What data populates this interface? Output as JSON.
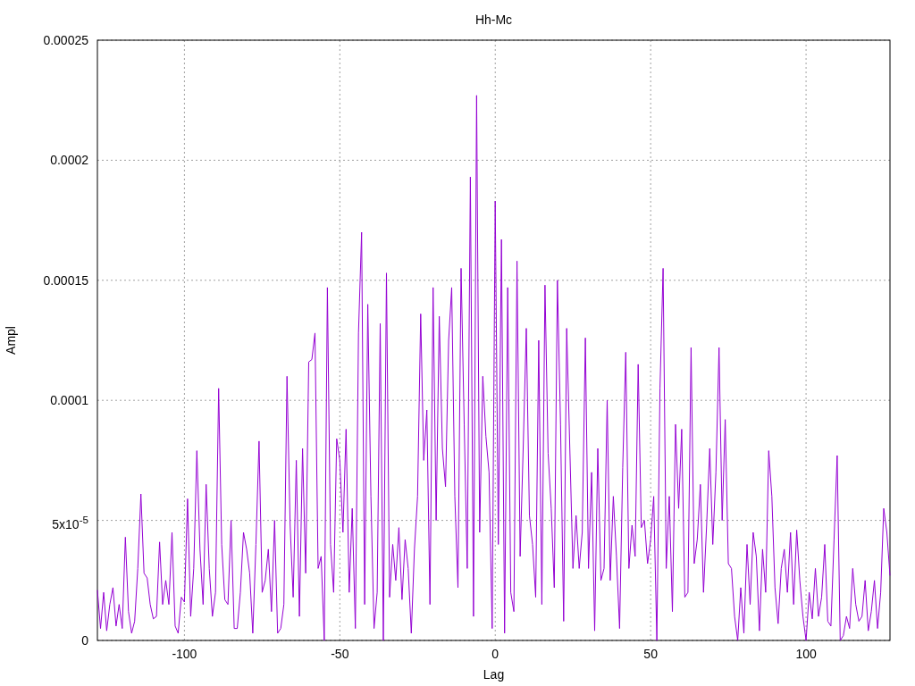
{
  "chart_data": {
    "type": "line",
    "title": "Hh-Mc",
    "xlabel": "Lag",
    "ylabel": "Ampl",
    "xlim": [
      -128,
      127
    ],
    "ylim": [
      0,
      0.00025
    ],
    "grid": true,
    "xticks": [
      -100,
      -50,
      0,
      50,
      100
    ],
    "yticks": [
      {
        "value": 0,
        "label": "0"
      },
      {
        "value": 5e-05,
        "label": "5x10$^{-5}$"
      },
      {
        "value": 0.0001,
        "label": "0.0001"
      },
      {
        "value": 0.00015,
        "label": "0.00015"
      },
      {
        "value": 0.0002,
        "label": "0.0002"
      },
      {
        "value": 0.00025,
        "label": "0.00025"
      }
    ],
    "x": [
      -128,
      -127,
      -126,
      -125,
      -124,
      -123,
      -122,
      -121,
      -120,
      -119,
      -118,
      -117,
      -116,
      -115,
      -114,
      -113,
      -112,
      -111,
      -110,
      -109,
      -108,
      -107,
      -106,
      -105,
      -104,
      -103,
      -102,
      -101,
      -100,
      -99,
      -98,
      -97,
      -96,
      -95,
      -94,
      -93,
      -92,
      -91,
      -90,
      -89,
      -88,
      -87,
      -86,
      -85,
      -84,
      -83,
      -82,
      -81,
      -80,
      -79,
      -78,
      -77,
      -76,
      -75,
      -74,
      -73,
      -72,
      -71,
      -70,
      -69,
      -68,
      -67,
      -66,
      -65,
      -64,
      -63,
      -62,
      -61,
      -60,
      -59,
      -58,
      -57,
      -56,
      -55,
      -54,
      -53,
      -52,
      -51,
      -50,
      -49,
      -48,
      -47,
      -46,
      -45,
      -44,
      -43,
      -42,
      -41,
      -40,
      -39,
      -38,
      -37,
      -36,
      -35,
      -34,
      -33,
      -32,
      -31,
      -30,
      -29,
      -28,
      -27,
      -26,
      -25,
      -24,
      -23,
      -22,
      -21,
      -20,
      -19,
      -18,
      -17,
      -16,
      -15,
      -14,
      -13,
      -12,
      -11,
      -10,
      -9,
      -8,
      -7,
      -6,
      -5,
      -4,
      -3,
      -2,
      -1,
      0,
      1,
      2,
      3,
      4,
      5,
      6,
      7,
      8,
      9,
      10,
      11,
      12,
      13,
      14,
      15,
      16,
      17,
      18,
      19,
      20,
      21,
      22,
      23,
      24,
      25,
      26,
      27,
      28,
      29,
      30,
      31,
      32,
      33,
      34,
      35,
      36,
      37,
      38,
      39,
      40,
      41,
      42,
      43,
      44,
      45,
      46,
      47,
      48,
      49,
      50,
      51,
      52,
      53,
      54,
      55,
      56,
      57,
      58,
      59,
      60,
      61,
      62,
      63,
      64,
      65,
      66,
      67,
      68,
      69,
      70,
      71,
      72,
      73,
      74,
      75,
      76,
      77,
      78,
      79,
      80,
      81,
      82,
      83,
      84,
      85,
      86,
      87,
      88,
      89,
      90,
      91,
      92,
      93,
      94,
      95,
      96,
      97,
      98,
      99,
      100,
      101,
      102,
      103,
      104,
      105,
      106,
      107,
      108,
      109,
      110,
      111,
      112,
      113,
      114,
      115,
      116,
      117,
      118,
      119,
      120,
      121,
      122,
      123,
      124,
      125,
      126,
      127
    ],
    "series": [
      {
        "color": "#9400d3",
        "values": [
          2.1e-05,
          5e-06,
          2e-05,
          4e-06,
          1.5e-05,
          2.2e-05,
          6e-06,
          1.5e-05,
          5e-06,
          4.3e-05,
          1.2e-05,
          3e-06,
          8e-06,
          3e-05,
          6.1e-05,
          2.8e-05,
          2.6e-05,
          1.5e-05,
          9e-06,
          1e-05,
          4.1e-05,
          1.5e-05,
          2.5e-05,
          1.5e-05,
          4.5e-05,
          6e-06,
          3e-06,
          1.8e-05,
          1.6e-05,
          5.9e-05,
          1e-05,
          3e-05,
          7.9e-05,
          3.8e-05,
          1.5e-05,
          6.5e-05,
          3e-05,
          1e-05,
          2e-05,
          0.000105,
          4e-05,
          1.7e-05,
          1.5e-05,
          5e-05,
          5e-06,
          5e-06,
          2e-05,
          4.5e-05,
          3.8e-05,
          2.8e-05,
          3e-06,
          4e-05,
          8.3e-05,
          2e-05,
          2.5e-05,
          3.8e-05,
          1.2e-05,
          5e-05,
          3e-06,
          5e-06,
          1.5e-05,
          0.00011,
          4.8e-05,
          1.8e-05,
          7.5e-05,
          1e-05,
          8e-05,
          2.8e-05,
          0.000116,
          0.000117,
          0.000128,
          3e-05,
          3.5e-05,
          0,
          0.000147,
          4e-05,
          2e-05,
          8.4e-05,
          7.5e-05,
          4.5e-05,
          8.8e-05,
          2e-05,
          5.5e-05,
          5e-06,
          0.000128,
          0.00017,
          1.5e-05,
          0.00014,
          6e-05,
          5e-06,
          2e-05,
          0.000132,
          0,
          0.000153,
          1.8e-05,
          4e-05,
          2.5e-05,
          4.7e-05,
          1.7e-05,
          4.2e-05,
          3e-05,
          3e-06,
          3.8e-05,
          6e-05,
          0.000136,
          7.5e-05,
          9.6e-05,
          1.5e-05,
          0.000147,
          5e-05,
          0.000135,
          8e-05,
          6.4e-05,
          0.000125,
          0.000147,
          6e-05,
          2.2e-05,
          0.000155,
          9e-05,
          3e-05,
          0.000193,
          1e-05,
          0.000227,
          4.5e-05,
          0.00011,
          8.5e-05,
          7e-05,
          5e-06,
          0.000183,
          4e-05,
          0.000167,
          3e-06,
          0.000147,
          2e-05,
          1.2e-05,
          0.000158,
          3.5e-05,
          8e-05,
          0.00013,
          5.2e-05,
          4e-05,
          1.8e-05,
          0.000125,
          1.5e-05,
          0.000148,
          7.8e-05,
          5.5e-05,
          2.2e-05,
          0.00015,
          9e-05,
          8e-06,
          0.00013,
          8e-05,
          3e-05,
          5.2e-05,
          3e-05,
          4.5e-05,
          0.000126,
          3e-05,
          7e-05,
          4e-06,
          8e-05,
          2.5e-05,
          3e-05,
          0.0001,
          2.5e-05,
          6e-05,
          3.5e-05,
          5e-06,
          7.2e-05,
          0.00012,
          3e-05,
          4.8e-05,
          3.5e-05,
          0.000115,
          4.7e-05,
          5e-05,
          3.2e-05,
          4.2e-05,
          6e-05,
          0,
          0.000105,
          0.000155,
          3e-05,
          6e-05,
          1.2e-05,
          9e-05,
          5.5e-05,
          8.8e-05,
          1.8e-05,
          2e-05,
          0.000122,
          3.2e-05,
          4.2e-05,
          6.5e-05,
          2e-05,
          4.8e-05,
          8e-05,
          4e-05,
          7e-05,
          0.000122,
          5e-05,
          9.2e-05,
          3.2e-05,
          3e-05,
          1e-05,
          0,
          2.2e-05,
          3e-06,
          4e-05,
          1.5e-05,
          4.5e-05,
          3.5e-05,
          4e-06,
          3.8e-05,
          2e-05,
          7.9e-05,
          6e-05,
          2.2e-05,
          7e-06,
          3e-05,
          3.8e-05,
          2e-05,
          4.5e-05,
          1.5e-05,
          4.6e-05,
          2.5e-05,
          1e-05,
          0,
          2e-05,
          9e-06,
          3e-05,
          1e-05,
          1.8e-05,
          4e-05,
          8e-06,
          6e-06,
          4.2e-05,
          7.7e-05,
          0,
          2e-06,
          1e-05,
          5e-06,
          3e-05,
          1.5e-05,
          8e-06,
          1e-05,
          2.5e-05,
          4e-06,
          1.2e-05,
          2.5e-05,
          5e-06,
          2e-05,
          5.5e-05,
          4.5e-05,
          2.7e-05
        ]
      }
    ]
  }
}
